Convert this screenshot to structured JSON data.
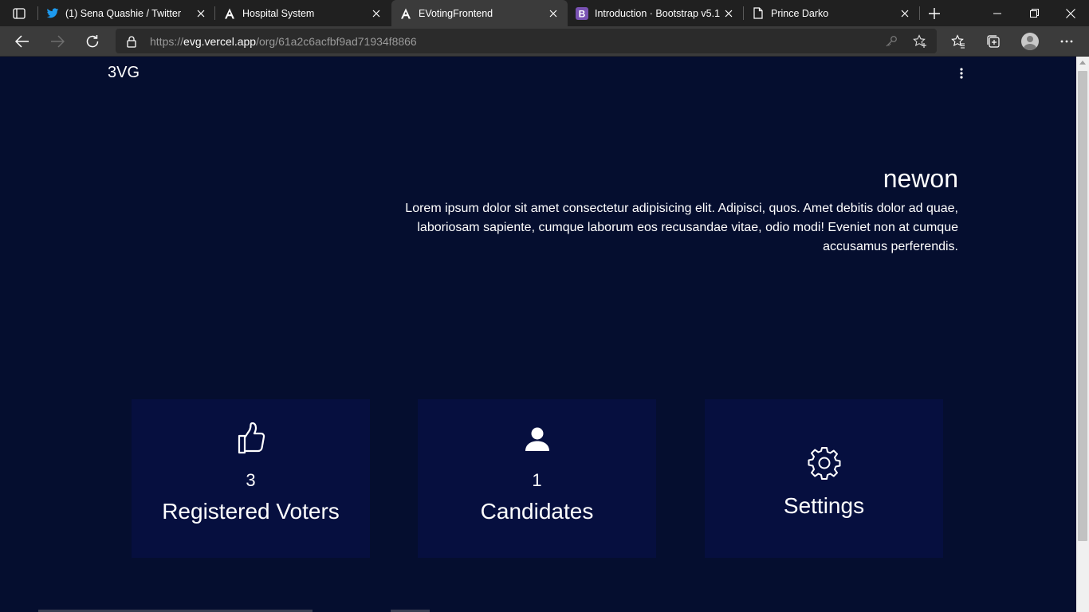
{
  "browser": {
    "tabs": [
      {
        "title": "(1) Sena Quashie / Twitter",
        "favicon": "twitter-icon",
        "active": false
      },
      {
        "title": "Hospital System",
        "favicon": "angular-icon",
        "active": false
      },
      {
        "title": "EVotingFrontend",
        "favicon": "angular-icon",
        "active": true
      },
      {
        "title": "Introduction · Bootstrap v5.1",
        "favicon": "bootstrap-icon",
        "active": false
      },
      {
        "title": "Prince Darko",
        "favicon": "page-icon",
        "active": false
      }
    ],
    "address": {
      "prefix": "https://",
      "host": "evg.vercel.app",
      "path": "/org/61a2c6acfbf9ad71934f8866"
    },
    "accent_colors": {
      "page_background": "#050e2f",
      "card_background": "#060f3f",
      "twitter_blue": "#1d9bf0",
      "bootstrap_purple": "#7952b3"
    }
  },
  "app": {
    "brand": "3VG",
    "org": {
      "name": "newon",
      "description": "Lorem ipsum dolor sit amet consectetur adipisicing elit. Adipisci, quos. Amet debitis dolor ad quae, laboriosam sapiente, cumque laborum eos recusandae vitae, odio modi! Eveniet non at cumque accusamus perferendis."
    },
    "cards": [
      {
        "icon": "thumbs-up-icon",
        "count": "3",
        "label": "Registered Voters"
      },
      {
        "icon": "person-icon",
        "count": "1",
        "label": "Candidates"
      },
      {
        "icon": "gear-icon",
        "label": "Settings"
      }
    ]
  }
}
